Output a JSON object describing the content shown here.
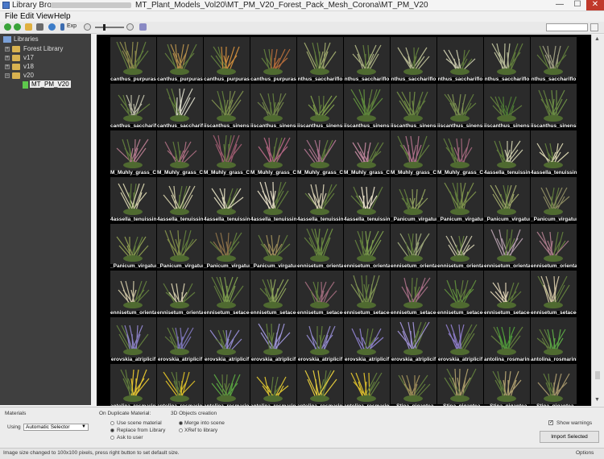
{
  "window": {
    "app_title": "Library Browser -",
    "path_title": "MT_Plant_Models_Vol20\\MT_PM_V20_Forest_Pack_Mesh_Corona\\MT_PM_V20",
    "minimize": "—",
    "maximize": "☐",
    "close": "✕"
  },
  "menu": [
    "File",
    "Edit",
    "View",
    "Help"
  ],
  "toolbar": {
    "icons": [
      "back-icon",
      "forward-icon",
      "folder-icon",
      "save-icon",
      "refresh-icon",
      "sort-icon",
      "expand-icon",
      "zoom-out-icon",
      "zoom-in-icon",
      "info-icon"
    ],
    "expand_label": "Exp"
  },
  "tree": {
    "root": "Libraries",
    "items": [
      {
        "label": "Forest Library",
        "level": 1,
        "expander": "+"
      },
      {
        "label": "v17",
        "level": 1,
        "expander": "+"
      },
      {
        "label": "v18",
        "level": 1,
        "expander": "+"
      },
      {
        "label": "v20",
        "level": 1,
        "expander": "−"
      }
    ],
    "selected": "MT_PM_V20"
  },
  "grid": {
    "rows": [
      {
        "labels": [
          "canthus_purpuras",
          "canthus_purpuras",
          "canthus_purpuras",
          "canthus_purpuras",
          "nthus_sacchariflo",
          "nthus_sacchariflo",
          "nthus_sacchariflo",
          "nthus_sacchariflo",
          "nthus_sacchariflo",
          "nthus_sacchariflo"
        ],
        "colors": [
          "#8d8a4c",
          "#b08c4a",
          "#c98a3c",
          "#b06a3a",
          "#9aa46a",
          "#a8ae80",
          "#b4b690",
          "#c4c4a8",
          "#b8bc98",
          "#9c9c80"
        ]
      },
      {
        "labels": [
          "canthus_sacchariflo",
          "canthus_sacchariflo",
          "iiscanthus_sinensi",
          "iiscanthus_sinensi",
          "iiscanthus_sinensi",
          "iiscanthus_sinensi",
          "iiscanthus_sinensi",
          "iiscanthus_sinensi",
          "iiscanthus_sinensi",
          "iiscanthus_sinensi"
        ],
        "colors": [
          "#b8b8a4",
          "#d0d0c0",
          "#7a8a4c",
          "#6e8048",
          "#7c9a4a",
          "#5e8a3c",
          "#6f8a44",
          "#7a8e50",
          "#4d7a34",
          "#6a8c44"
        ]
      },
      {
        "labels": [
          "M_Muhly_grass_C",
          "M_Muhly_grass_C",
          "M_Muhly_grass_C",
          "M_Muhly_grass_C",
          "M_Muhly_grass_C",
          "M_Muhly_grass_C",
          "M_Muhly_grass_C",
          "M_Muhly_grass_C",
          "4assella_tenuissin",
          "4assella_tenuissin"
        ],
        "colors": [
          "#b0788a",
          "#a46a7c",
          "#9a5a6e",
          "#b06480",
          "#a8708a",
          "#bc849a",
          "#aa6e86",
          "#9c6478",
          "#c8c8a8",
          "#d4d0ac"
        ]
      },
      {
        "labels": [
          "4assella_tenuissin",
          "4assella_tenuissin",
          "4assella_tenuissin",
          "4assella_tenuissin",
          "4assella_tenuissin",
          "4assella_tenuissin",
          "_Panicum_virgatur",
          "_Panicum_virgatur",
          "_Panicum_virgatur",
          "_Panicum_virgatur"
        ],
        "colors": [
          "#d0cca8",
          "#c8c4a0",
          "#d8d4b8",
          "#e0d8c0",
          "#d4ccb0",
          "#e4dcc4",
          "#8a9a5a",
          "#7a8e4a",
          "#9aa268",
          "#8a8860"
        ]
      },
      {
        "labels": [
          "_Panicum_virgatur",
          "_Panicum_virgatur",
          "_Panicum_virgatur",
          "_Panicum_virgatur",
          "ennisetum_orienta",
          "ennisetum_orienta",
          "ennisetum_orienta",
          "ennisetum_orienta",
          "ennisetum_orienta",
          "ennisetum_orienta"
        ],
        "colors": [
          "#8a9850",
          "#7e8a48",
          "#8a7048",
          "#9a8a58",
          "#6a8a40",
          "#7a9a4c",
          "#9aa478",
          "#c4c0a4",
          "#b09aa8",
          "#a87888"
        ]
      },
      {
        "labels": [
          "ennisetum_orienta",
          "ennisetum_orienta",
          "ennisetum_setacec",
          "ennisetum_setacec",
          "ennisetum_setacec",
          "ennisetum_setacec",
          "ennisetum_setacec",
          "ennisetum_setacec",
          "ennisetum_setacec",
          "ennisetum_setacec"
        ],
        "colors": [
          "#c8c0a0",
          "#d0c8a8",
          "#7a9a4c",
          "#8aa058",
          "#9a6878",
          "#7a8e50",
          "#a06a80",
          "#5e8a3c",
          "#d8ccb0",
          "#ccc0a0"
        ]
      },
      {
        "labels": [
          "erovskia_atriplicif",
          "erovskia_atriplicif",
          "erovskia_atriplicif",
          "erovskia_atriplicif",
          "erovskia_atriplicif",
          "erovskia_atriplicif",
          "erovskia_atriplicif",
          "erovskia_atriplicif",
          "antolina_rosmarini",
          "antolina_rosmarini"
        ],
        "colors": [
          "#8a80c4",
          "#7c74b8",
          "#9088cc",
          "#9a92d4",
          "#8c84c4",
          "#8a7ec8",
          "#9c8ed0",
          "#8878c0",
          "#4e9a3a",
          "#5aa444"
        ]
      },
      {
        "labels": [
          "antolina_rosmarini",
          "antolina_rosmarini",
          "antolina_rosmarini",
          "antolina_rosmarini",
          "antolina_rosmarini",
          "antolina_rosmarini",
          "_Stipa_gigantea",
          "_Stipa_gigantea",
          "_Stipa_gigantea",
          "_Stipa_gigantea"
        ],
        "colors": [
          "#e0c030",
          "#d4b828",
          "#58a040",
          "#d8c030",
          "#e0c83c",
          "#d8bc2c",
          "#9a8a58",
          "#a89a68",
          "#b0a070",
          "#a4946a"
        ]
      }
    ]
  },
  "bottom": {
    "materials_title": "Materials",
    "using_label": "Using",
    "using_value": "Automatic Selector",
    "duplicate_title": "On Duplicate Material:",
    "duplicate_options": [
      {
        "label": "Use scene material",
        "selected": false
      },
      {
        "label": "Replace from Library",
        "selected": true
      },
      {
        "label": "Ask to user",
        "selected": false
      }
    ],
    "creation_title": "3D Objects creation",
    "creation_options": [
      {
        "label": "Merge into scene",
        "selected": true
      },
      {
        "label": "XRef to library",
        "selected": false
      }
    ],
    "show_warnings_label": "Show warnings",
    "show_warnings_checked": true,
    "import_button": "Import Selected"
  },
  "status": {
    "message": "Image size changed to 100x100 pixels, press right button to set default size.",
    "options": "Options"
  }
}
